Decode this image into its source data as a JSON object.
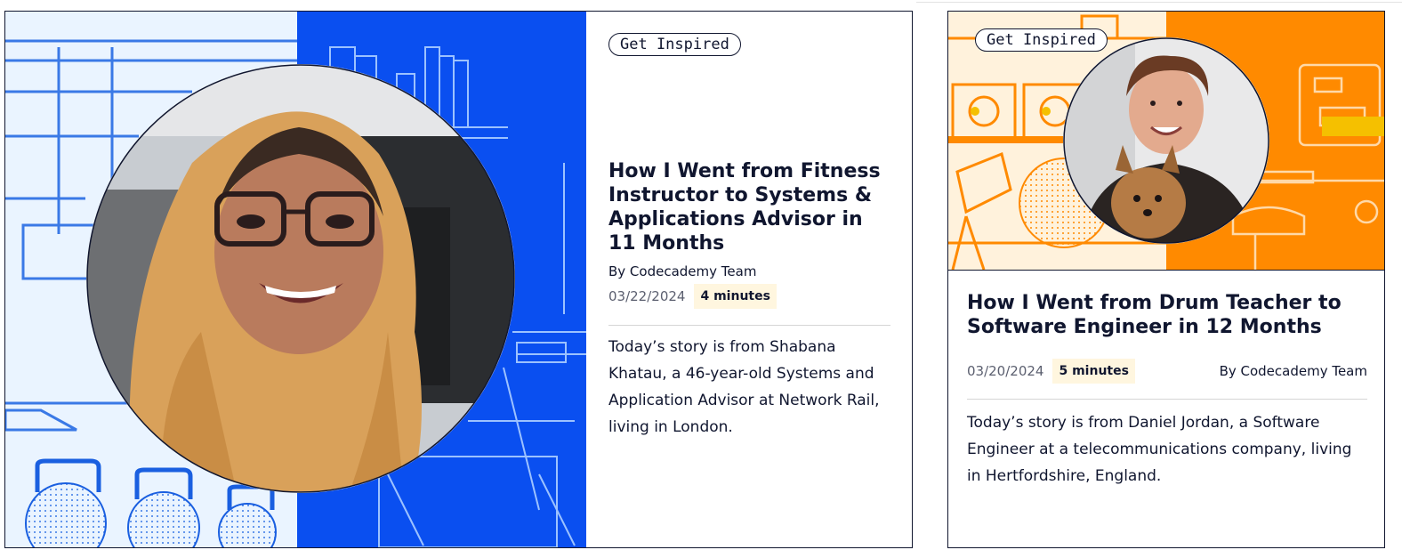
{
  "cards": [
    {
      "tag": "Get Inspired",
      "title": "How I Went from Fitness Instructor to Systems & Applications Advisor in 11 Months",
      "author": "By Codecademy Team",
      "date": "03/22/2024",
      "read_time": "4 minutes",
      "description": "Today’s story is from Shabana Khatau, a 46-year-old Systems and Application Advisor at Network Rail, living in London.",
      "colors": {
        "art_left": "#eaf4ff",
        "art_right": "#0a4ff0",
        "line": "#3a79e6"
      }
    },
    {
      "tag": "Get Inspired",
      "title": "How I Went from Drum Teacher to Software Engineer in 12 Months",
      "author": "By Codecademy Team",
      "date": "03/20/2024",
      "read_time": "5 minutes",
      "description": "Today’s story is from Daniel Jordan, a Software Engineer at a telecommunications company, living in Hertfordshire, England.",
      "colors": {
        "art_left": "#fff2dc",
        "art_right": "#ff8a00",
        "line": "#ff8a00"
      }
    }
  ]
}
